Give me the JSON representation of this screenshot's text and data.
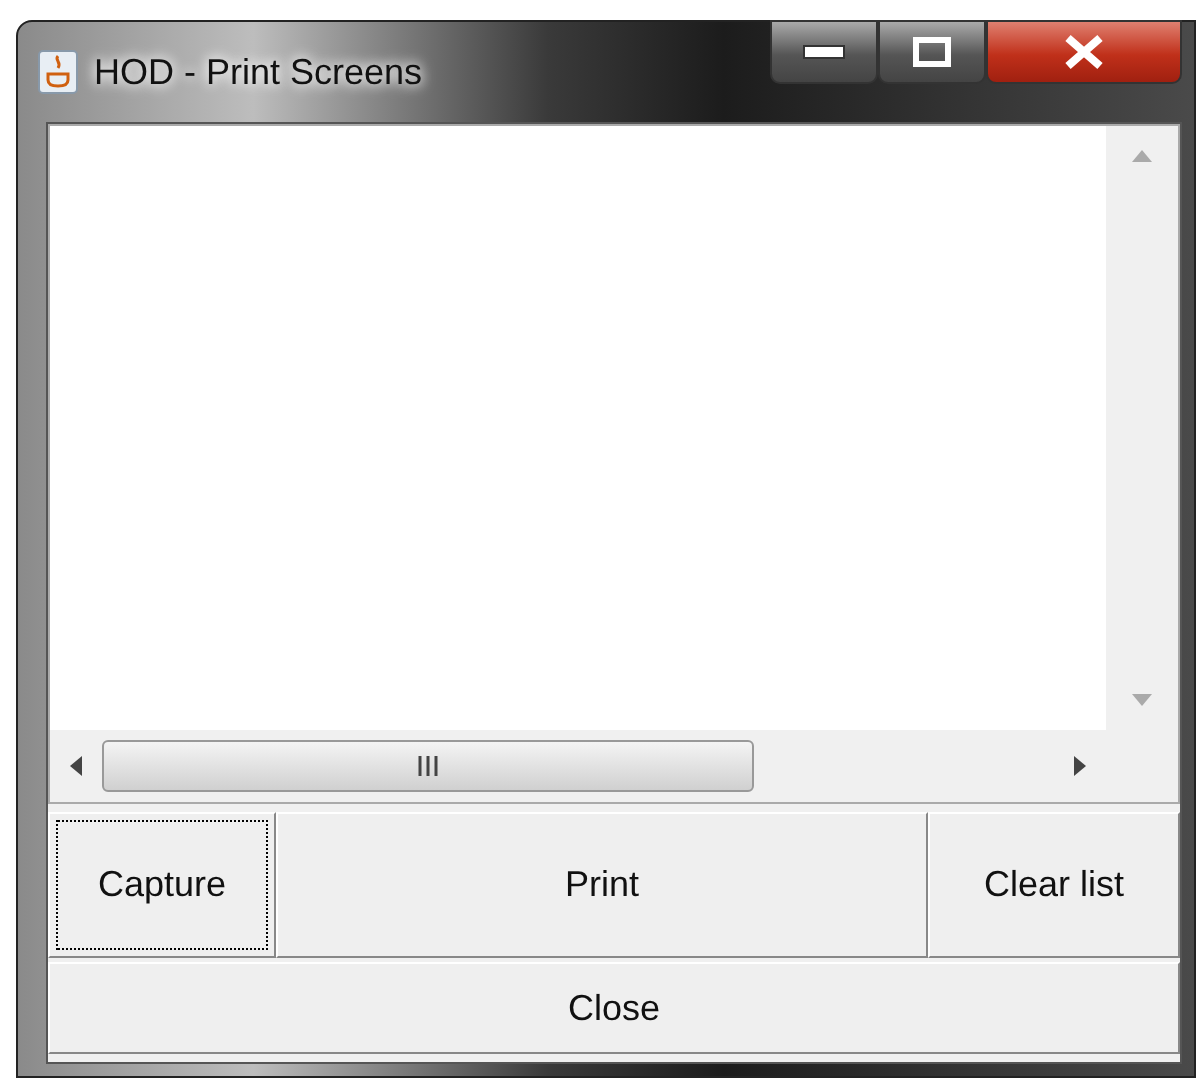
{
  "window": {
    "title": "HOD - Print Screens"
  },
  "buttons": [
    {
      "label": "Capture",
      "focused": true
    },
    {
      "label": "Print",
      "focused": false
    },
    {
      "label": "Clear list",
      "focused": false
    }
  ],
  "close_button": {
    "label": "Close"
  }
}
